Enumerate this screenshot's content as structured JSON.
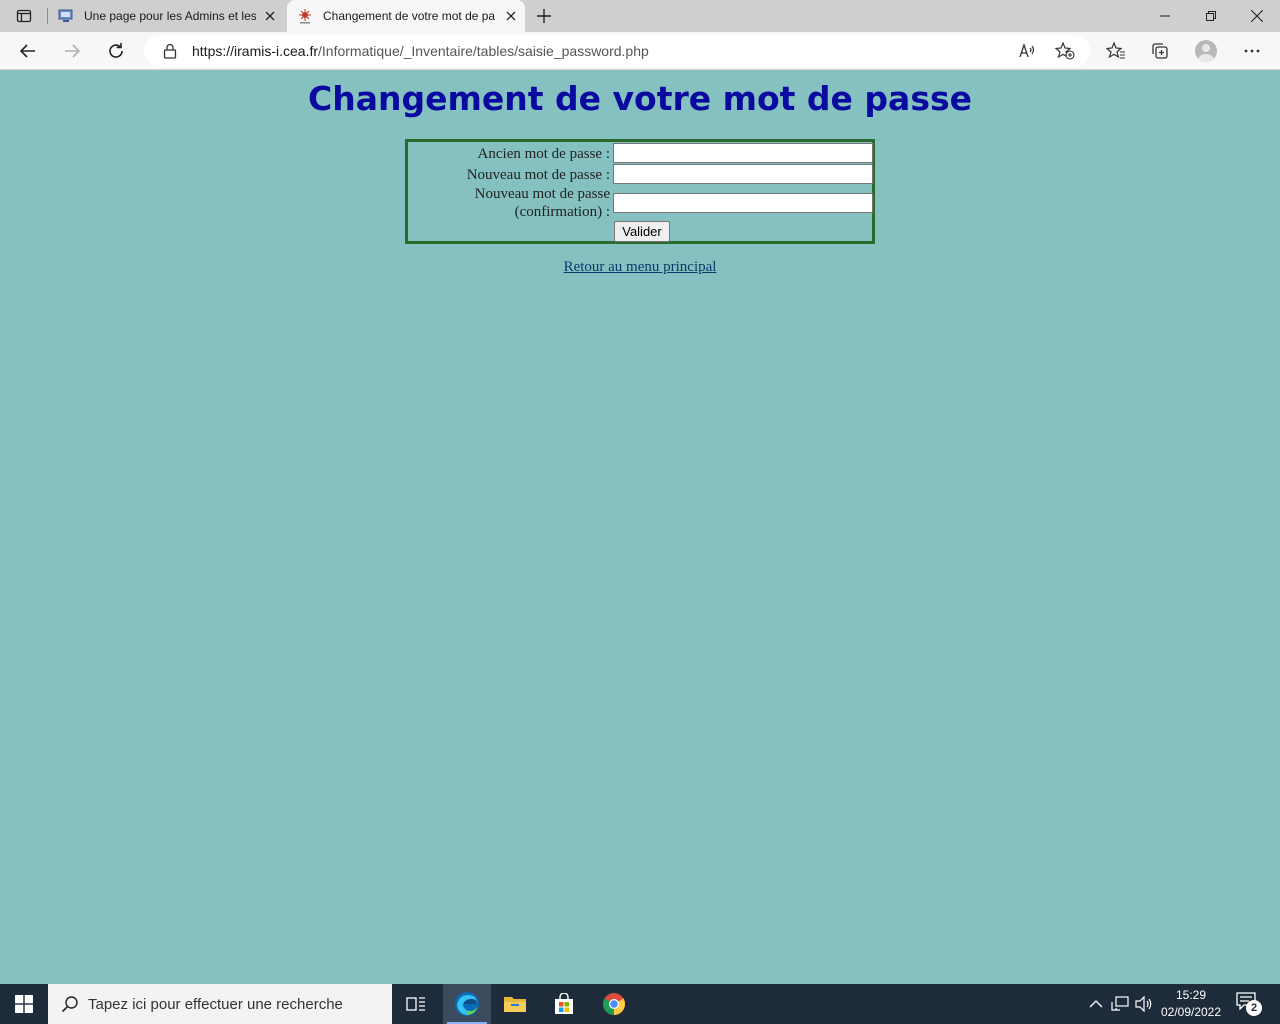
{
  "browser": {
    "tabs": [
      {
        "title": "Une page pour les Admins et les",
        "favicon": "monitor-favicon",
        "active": false
      },
      {
        "title": "Changement de votre mot de pa",
        "favicon": "site-favicon",
        "active": true
      }
    ],
    "address": {
      "url_host": "https://iramis-i.cea.fr",
      "url_path": "/Informatique/_Inventaire/tables/saisie_password.php"
    },
    "icons": [
      "sidebar-icon",
      "close-icon",
      "plus-icon",
      "minimize-icon",
      "restore-icon",
      "back-icon",
      "forward-icon",
      "refresh-icon",
      "lock-icon",
      "read-aloud-icon",
      "add-favorite-icon",
      "favorites-icon",
      "collections-icon",
      "profile-avatar",
      "more-icon"
    ]
  },
  "page": {
    "title": "Changement de votre mot de passe",
    "form": {
      "old_password_label": "Ancien mot de passe :",
      "new_password_label": "Nouveau mot de passe :",
      "confirm_label_line1": "Nouveau mot de passe",
      "confirm_label_line2": "(confirmation) :",
      "old_password_value": "",
      "new_password_value": "",
      "confirm_password_value": "",
      "submit_label": "Valider"
    },
    "back_link": "Retour au menu principal"
  },
  "taskbar": {
    "search_placeholder": "Tapez ici pour effectuer une recherche",
    "apps": [
      "task-view-icon",
      "edge-icon",
      "file-explorer-icon",
      "store-icon",
      "chrome-icon"
    ],
    "time": "15:29",
    "date": "02/09/2022",
    "notification_count": "2"
  },
  "colors": {
    "page_background": "#84c1c0",
    "title": "#0a0aa0",
    "form_border": "#2b6a2b",
    "link": "#0a3a6a",
    "taskbar": "#1e2b3a"
  }
}
